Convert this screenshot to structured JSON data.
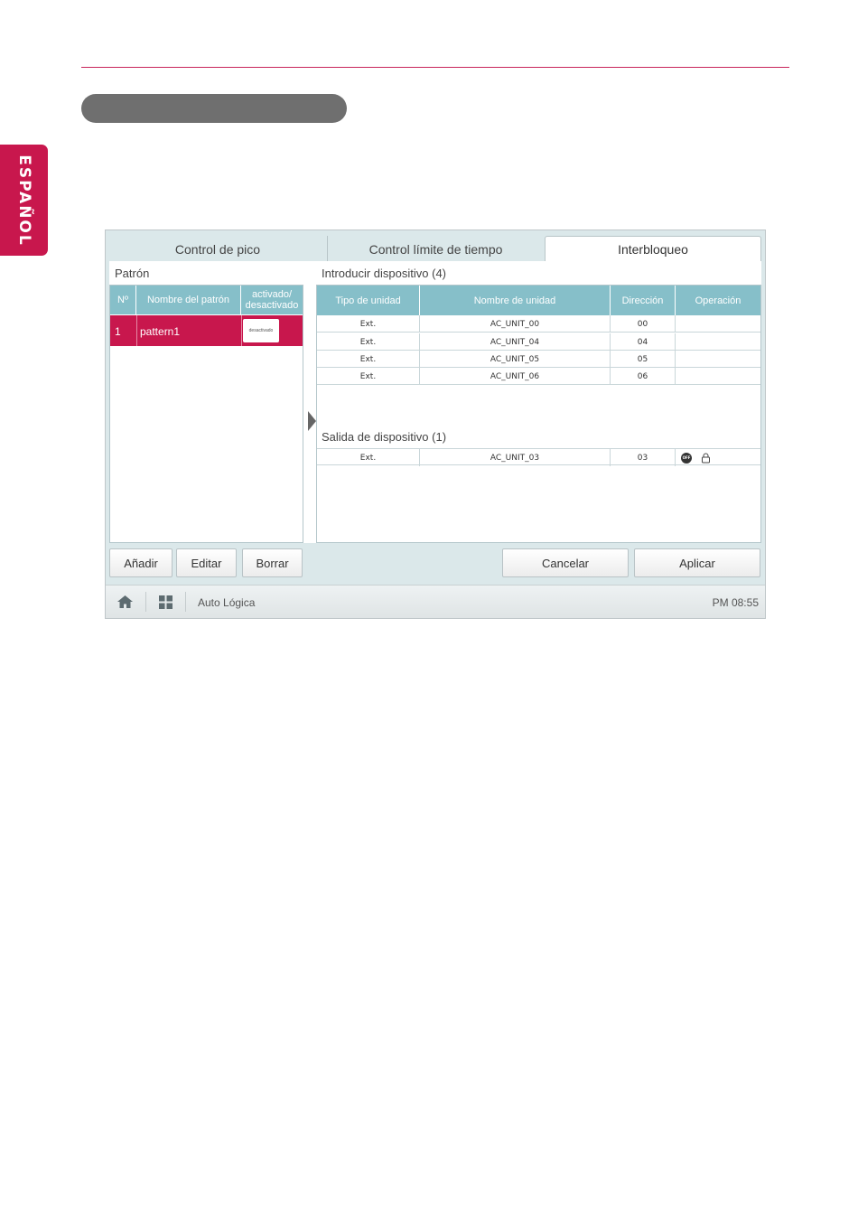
{
  "language_tab": "ESPAÑOL",
  "tabs": [
    "Control de pico",
    "Control límite de tiempo",
    "Interbloqueo"
  ],
  "pattern_panel": {
    "title": "Patrón",
    "headers": {
      "no": "Nº",
      "name": "Nombre del patrón",
      "active_line1": "activado/",
      "active_line2": "desactivado"
    },
    "rows": [
      {
        "no": "1",
        "name": "pattern1",
        "state": "desactivado"
      }
    ]
  },
  "input_devices": {
    "title": "Introducir dispositivo (4)",
    "headers": {
      "type": "Tipo de unidad",
      "name": "Nombre de unidad",
      "address": "Dirección",
      "operation": "Operación"
    },
    "rows": [
      {
        "type": "Ext.",
        "name": "AC_UNIT_00",
        "address": "00"
      },
      {
        "type": "Ext.",
        "name": "AC_UNIT_04",
        "address": "04"
      },
      {
        "type": "Ext.",
        "name": "AC_UNIT_05",
        "address": "05"
      },
      {
        "type": "Ext.",
        "name": "AC_UNIT_06",
        "address": "06"
      }
    ]
  },
  "output_devices": {
    "title": "Salida de dispositivo (1)",
    "rows": [
      {
        "type": "Ext.",
        "name": "AC_UNIT_03",
        "address": "03",
        "op_badge": "OFF",
        "op_icons": [
          "off-icon",
          "lock-icon"
        ]
      }
    ]
  },
  "buttons": {
    "add": "Añadir",
    "edit": "Editar",
    "delete": "Borrar",
    "cancel": "Cancelar",
    "apply": "Aplicar"
  },
  "statusbar": {
    "title": "Auto Lógica",
    "time": "PM 08:55",
    "icons": [
      "home-icon",
      "grid-icon"
    ]
  },
  "colors": {
    "accent": "#c8174d",
    "header": "#86bfc9",
    "background": "#dbe8ea"
  }
}
